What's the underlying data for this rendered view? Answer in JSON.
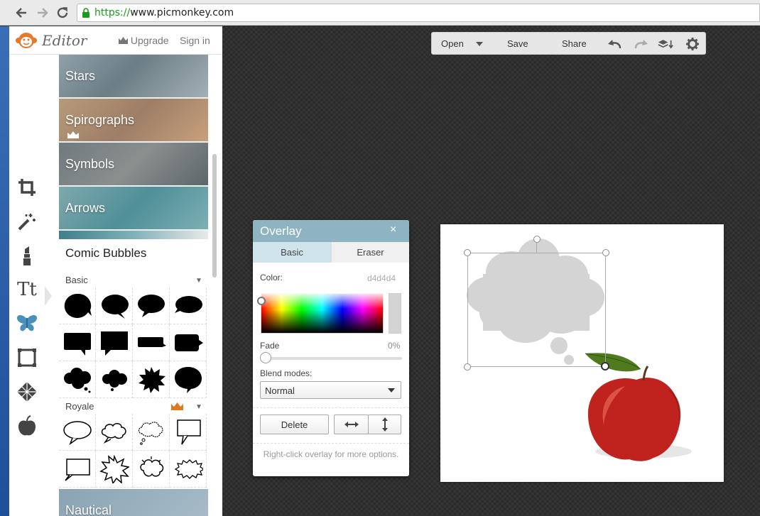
{
  "browser": {
    "url_scheme": "https://",
    "url_rest": "www.picmonkey.com"
  },
  "editor": {
    "title": "Editor",
    "upgrade_label": "Upgrade",
    "signin_label": "Sign in"
  },
  "tools": [
    {
      "icon": "crop-icon"
    },
    {
      "icon": "magic-wand-icon"
    },
    {
      "icon": "lipstick-icon"
    },
    {
      "icon": "text-icon",
      "label": "Tt"
    },
    {
      "icon": "butterfly-icon"
    },
    {
      "icon": "frame-icon"
    },
    {
      "icon": "texture-icon"
    },
    {
      "icon": "apple-icon"
    }
  ],
  "categories": {
    "stars": "Stars",
    "spirographs": "Spirographs",
    "symbols": "Symbols",
    "arrows": "Arrows",
    "nautical": "Nautical"
  },
  "comic": {
    "title": "Comic Bubbles",
    "basic_label": "Basic",
    "royale_label": "Royale"
  },
  "toolbar": {
    "open": "Open",
    "save": "Save",
    "share": "Share"
  },
  "overlay": {
    "title": "Overlay",
    "close": "×",
    "tab_basic": "Basic",
    "tab_eraser": "Eraser",
    "color_label": "Color:",
    "color_value": "d4d4d4",
    "fade_label": "Fade",
    "fade_value": "0%",
    "blend_label": "Blend modes:",
    "blend_value": "Normal",
    "delete_label": "Delete",
    "hint": "Right-click overlay for more options."
  },
  "colors": {
    "overlay_header": "#8fb4c1",
    "active_tab": "#cfe4ea",
    "cloud_fill": "#d4d4d4",
    "tool_active": "#3f8cbf",
    "crown": "#e07a1f"
  }
}
